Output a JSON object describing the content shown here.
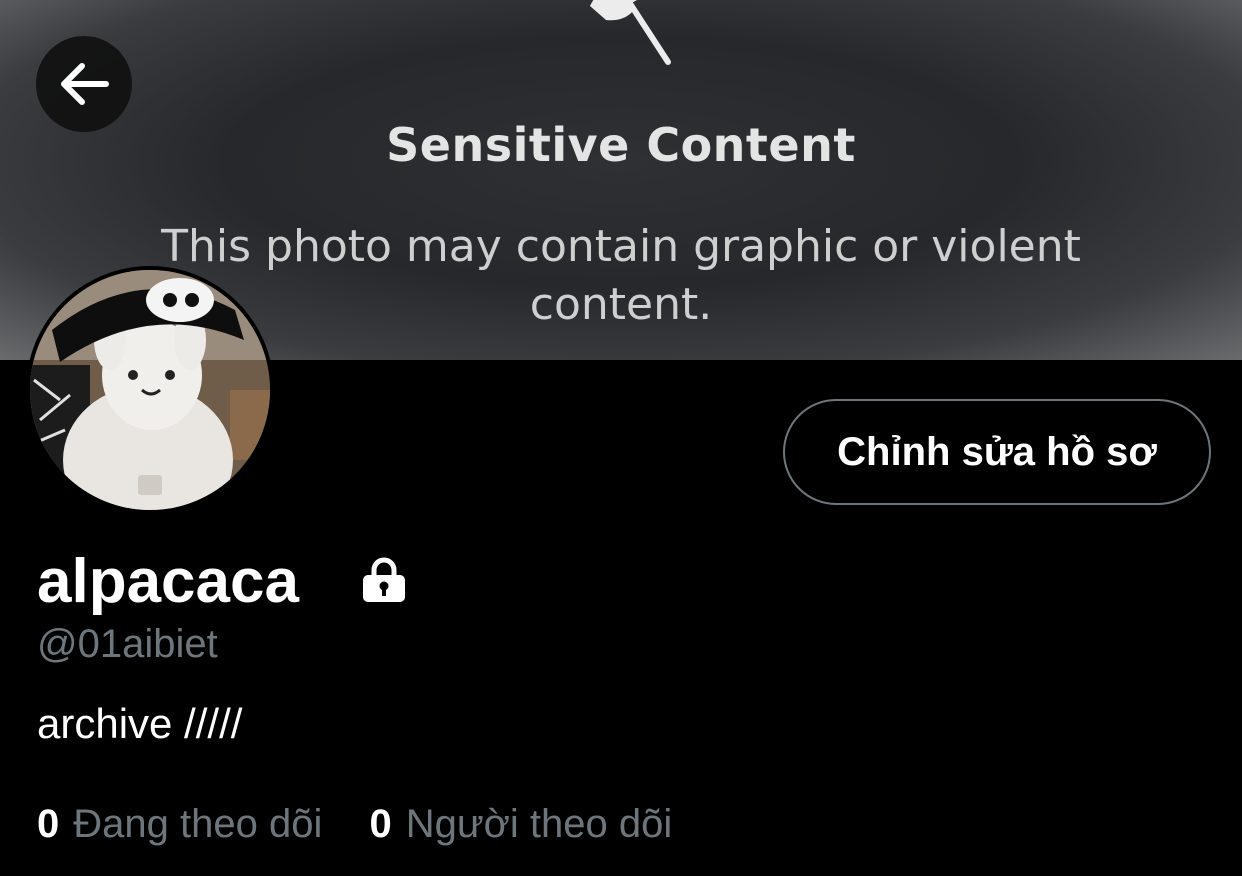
{
  "banner": {
    "sensitive_title": "Sensitive Content",
    "sensitive_description": "This photo may contain graphic or violent content."
  },
  "header": {
    "back_icon": "arrow-left-icon"
  },
  "profile": {
    "edit_button_label": "Chỉnh sửa hồ sơ",
    "display_name": "alpacaca",
    "lock_icon": "lock-icon",
    "handle": "@01aibiet",
    "bio": "archive /////"
  },
  "stats": {
    "following_count": "0",
    "following_label": "Đang theo dõi",
    "followers_count": "0",
    "followers_label": "Người theo dõi"
  },
  "colors": {
    "background": "#000000",
    "secondary_text": "#6e767d",
    "border": "#6e767d"
  }
}
